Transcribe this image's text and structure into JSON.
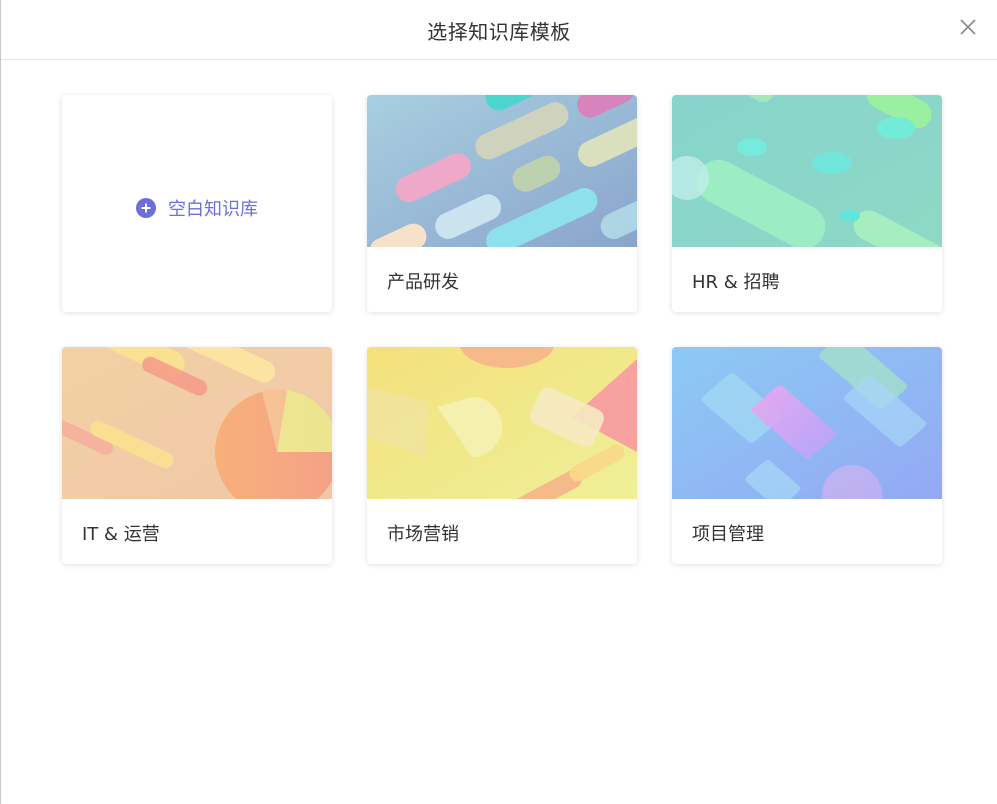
{
  "dialog": {
    "title": "选择知识库模板",
    "close_icon": "close-icon"
  },
  "blank_card": {
    "icon": "plus-circle-icon",
    "label": "空白知识库",
    "accent": "#6c6fd9"
  },
  "templates": [
    {
      "label": "产品研发",
      "bg": "#9fb9d6"
    },
    {
      "label": "HR & 招聘",
      "bg": "#8dd8cc"
    },
    {
      "label": "IT & 运营",
      "bg": "#f2d2a6"
    },
    {
      "label": "市场营销",
      "bg": "#f0e890"
    },
    {
      "label": "项目管理",
      "bg": "#8fb4f2"
    }
  ]
}
